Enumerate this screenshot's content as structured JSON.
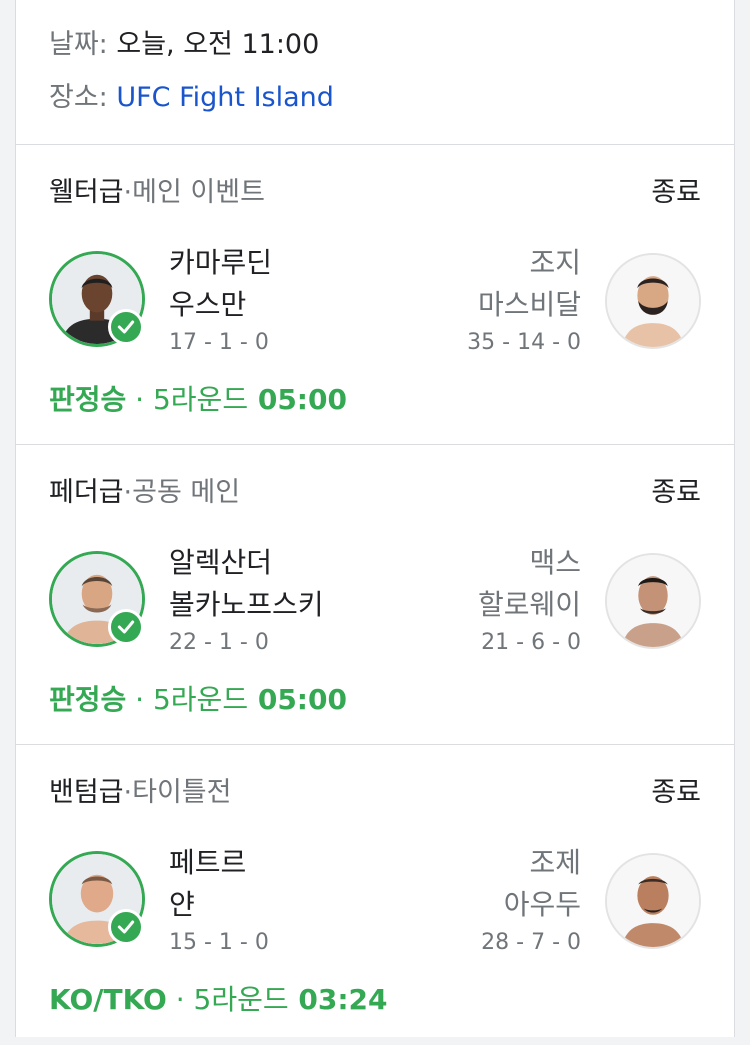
{
  "event": {
    "date_label": "날짜:",
    "date_value": "오늘, 오전 11:00",
    "venue_label": "장소:",
    "venue_value": "UFC Fight Island"
  },
  "colors": {
    "win": "#34a853",
    "link": "#1a55cc",
    "muted": "#70757a"
  },
  "fights": [
    {
      "weight": "웰터급",
      "separator": "·",
      "billing": "메인 이벤트",
      "status": "종료",
      "winner": {
        "line1": "카마루딘",
        "line2": "우스만",
        "record": "17 - 1 - 0",
        "icon": "checkmark-icon"
      },
      "loser": {
        "line1": "조지",
        "line2": "마스비달",
        "record": "35 - 14 - 0"
      },
      "result_method": "판정승",
      "result_sep": " · ",
      "result_round": "5라운드",
      "result_time": "05:00"
    },
    {
      "weight": "페더급",
      "separator": "·",
      "billing": "공동 메인",
      "status": "종료",
      "winner": {
        "line1": "알렉산더",
        "line2": "볼카노프스키",
        "record": "22 - 1 - 0",
        "icon": "checkmark-icon"
      },
      "loser": {
        "line1": "맥스",
        "line2": "할로웨이",
        "record": "21 - 6 - 0"
      },
      "result_method": "판정승",
      "result_sep": " · ",
      "result_round": "5라운드",
      "result_time": "05:00"
    },
    {
      "weight": "밴텀급",
      "separator": "·",
      "billing": "타이틀전",
      "status": "종료",
      "winner": {
        "line1": "페트르",
        "line2": "얀",
        "record": "15 - 1 - 0",
        "icon": "checkmark-icon"
      },
      "loser": {
        "line1": "조제",
        "line2": "아우두",
        "record": "28 - 7 - 0"
      },
      "result_method": "KO/TKO",
      "result_sep": " · ",
      "result_round": "5라운드",
      "result_time": "03:24"
    }
  ]
}
